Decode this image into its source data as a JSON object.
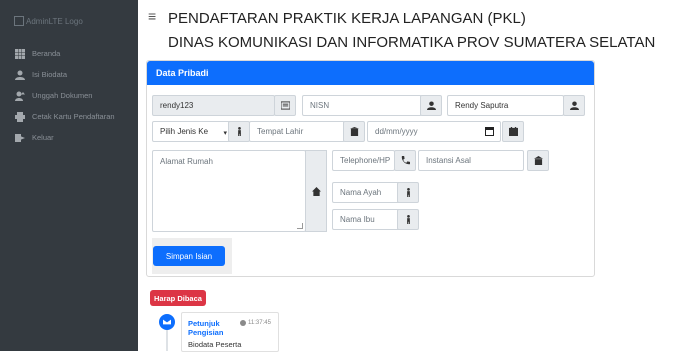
{
  "sidebar": {
    "logo_alt": "AdminLTE Logo",
    "items": [
      {
        "label": "Beranda",
        "icon": "grid-icon"
      },
      {
        "label": "Isi Biodata",
        "icon": "user-icon"
      },
      {
        "label": "Unggah Dokumen",
        "icon": "user-upload-icon"
      },
      {
        "label": "Cetak Kartu Pendaftaran",
        "icon": "print-icon"
      },
      {
        "label": "Keluar",
        "icon": "exit-icon"
      }
    ]
  },
  "header": {
    "menu_icon": "≡",
    "title_line1": "PENDAFTARAN PRAKTIK KERJA LAPANGAN (PKL)",
    "title_line2": "DINAS KOMUNIKASI DAN INFORMATIKA PROV SUMATERA SELATAN"
  },
  "form": {
    "header": "Data Pribadi",
    "username_value": "rendy123",
    "nisn_placeholder": "NISN",
    "name_value": "Rendy Saputra",
    "gender_selected": "Pilih Jenis Ke",
    "birthplace_placeholder": "Tempat Lahir",
    "birthdate_placeholder": "dd/mm/yyyy",
    "address_placeholder": "Alamat Rumah",
    "phone_placeholder": "Telephone/HP",
    "school_placeholder": "Instansi Asal",
    "father_placeholder": "Nama Ayah",
    "mother_placeholder": "Nama Ibu",
    "save_label": "Simpan Isian"
  },
  "notice": {
    "badge": "Harap Dibaca",
    "title": "Petunjuk Pengisian",
    "time": "11:37:45",
    "body": "Biodata Peserta"
  },
  "colors": {
    "primary": "#0d6efd",
    "danger": "#dc3545",
    "sidebar": "#343a40"
  }
}
